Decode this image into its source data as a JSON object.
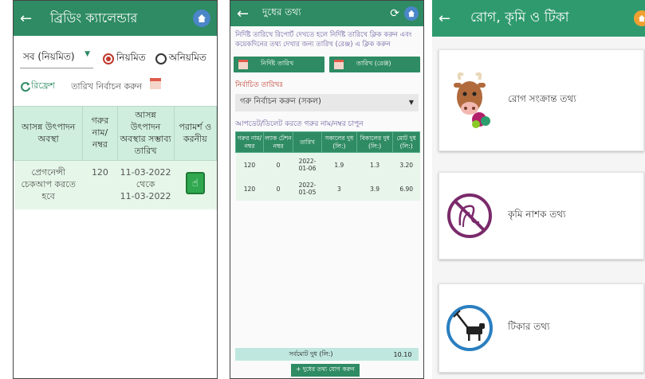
{
  "breeding": {
    "title": "ব্রিডিং ক্যালেন্ডার",
    "filter_value": "সব (নিয়মিত)",
    "radio_regular": "নিয়মিত",
    "radio_irregular": "অনিয়মিত",
    "refresh_label": "রিফ্রেশ",
    "date_select_label": "তারিখ নির্বাচন করুন",
    "headers": [
      "আসন্ন উৎপাদন অবস্থা",
      "গরুর নাম/ নম্বর",
      "আসন্ন উৎপাদন অবস্থার সম্ভাব্য তারিখ",
      "পরামর্শ ও করনীয়"
    ],
    "row": {
      "status": "প্রেগনেন্সী চেকআপ করতে হবে",
      "cow_id": "120",
      "date_from": "11-03-2022",
      "date_sep": "থেকে",
      "date_to": "11-03-2022"
    }
  },
  "milk": {
    "title": "দুধের তথ্য",
    "hint": "নির্দিষ্ট তারিখে রিপোর্ট দেখতে হলে নির্দিষ্ট তারিখে ক্লিক করুন এবং কয়েকদিনের তথ্য দেখার জন্য তারিখ (রেঞ্জ) এ ক্লিক করুন",
    "specific_date_btn": "নির্দিষ্ট তারিখ",
    "range_date_btn": "তারিখ (রেঞ্জ)",
    "selected_date_label": "নির্বাচিত তারিখঃ",
    "cow_select": "গরু নির্বাচন করুন (সকল)",
    "update_hint": "আপডেট/ডিলেট করতে গরুর নাম/নম্বর চাপুন",
    "headers": [
      "গরুর নাম/ নম্বর",
      "ল্যাক টেশন নম্বর",
      "তারিখ",
      "সকালের দুধ (লি:)",
      "বিকালের দুধ (লি:)",
      "মোট দুধ (লি:)"
    ],
    "rows": [
      [
        "120",
        "0",
        "2022-01-06",
        "1.9",
        "1.3",
        "3.20"
      ],
      [
        "120",
        "0",
        "2022-01-05",
        "3",
        "3.9",
        "6.90"
      ]
    ],
    "total_label": "সর্বমোট দুধ (লি:)",
    "total_value": "10.10",
    "add_btn": "+ দুধের তথ্য যোগ করুন"
  },
  "disease": {
    "title": "রোগ, কৃমি ও টিকা",
    "cards": [
      {
        "label": "রোগ সংক্রান্ত তথ্য",
        "icon": "sick-cow-icon"
      },
      {
        "label": "কৃমি নাশক তথ্য",
        "icon": "no-worm-icon"
      },
      {
        "label": "টিকার তথ্য",
        "icon": "vaccine-cow-icon"
      }
    ]
  },
  "colors": {
    "primary": "#2e8b63",
    "table_header": "#cfeedd",
    "table_row": "#e6f7e9",
    "radio": "#c0392b",
    "hint_text": "#6a5b9e"
  }
}
